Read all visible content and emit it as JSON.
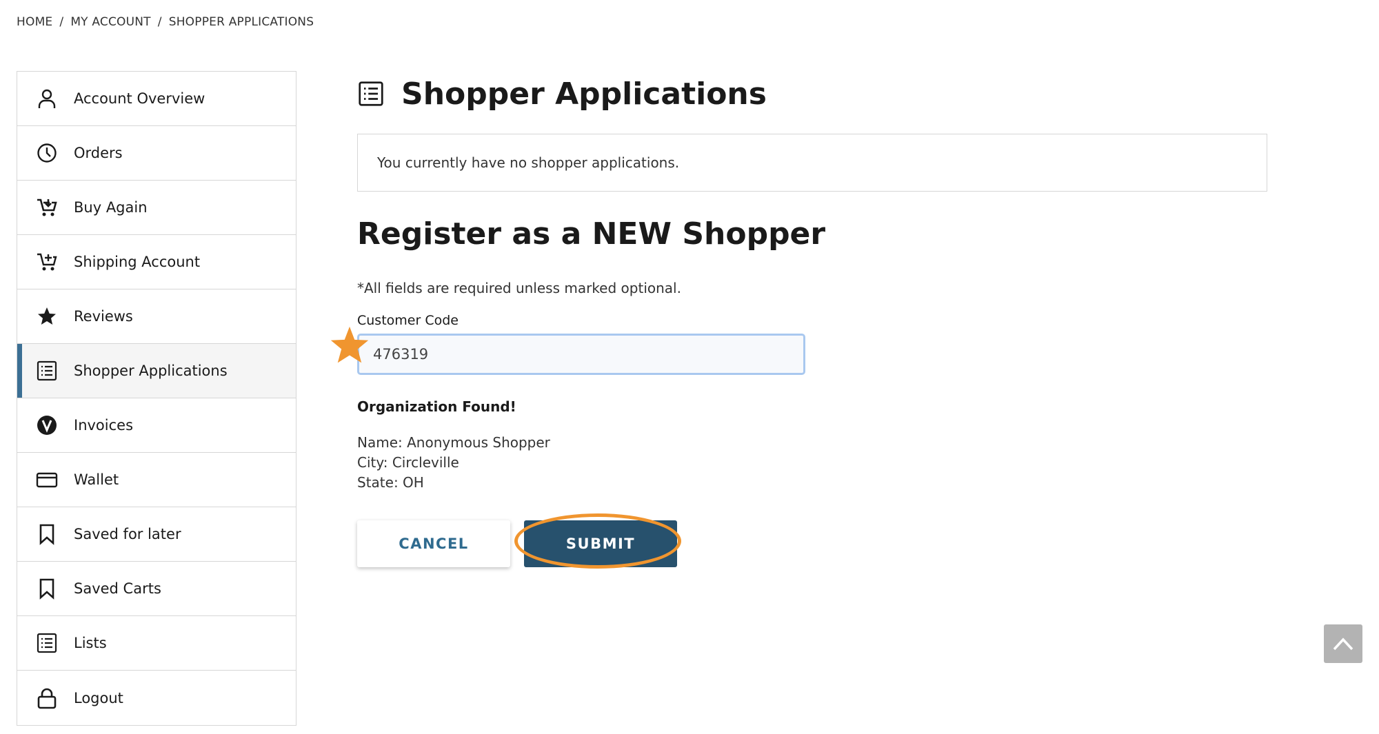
{
  "breadcrumb": {
    "items": [
      "HOME",
      "MY ACCOUNT",
      "SHOPPER APPLICATIONS"
    ],
    "separator": "/"
  },
  "sidebar": {
    "items": [
      {
        "label": "Account Overview",
        "icon": "user-icon"
      },
      {
        "label": "Orders",
        "icon": "clock-icon"
      },
      {
        "label": "Buy Again",
        "icon": "cart-download-icon"
      },
      {
        "label": "Shipping Account",
        "icon": "cart-add-icon"
      },
      {
        "label": "Reviews",
        "icon": "star-icon"
      },
      {
        "label": "Shopper Applications",
        "icon": "list-icon",
        "active": true
      },
      {
        "label": "Invoices",
        "icon": "v-circle-icon"
      },
      {
        "label": "Wallet",
        "icon": "credit-card-icon"
      },
      {
        "label": "Saved for later",
        "icon": "bookmark-icon"
      },
      {
        "label": "Saved Carts",
        "icon": "bookmark-icon"
      },
      {
        "label": "Lists",
        "icon": "list-icon"
      },
      {
        "label": "Logout",
        "icon": "lock-icon"
      }
    ]
  },
  "main": {
    "title": "Shopper Applications",
    "title_icon": "list-icon",
    "notice": "You currently have no shopper applications.",
    "register_title": "Register as a NEW Shopper",
    "required_note": "*All fields are required unless marked optional.",
    "customer_code_label": "Customer Code",
    "customer_code_value": "476319",
    "org_found": "Organization Found!",
    "org_name": "Name: Anonymous Shopper",
    "org_city": "City: Circleville",
    "org_state": "State: OH",
    "cancel_label": "CANCEL",
    "submit_label": "SUBMIT"
  },
  "colors": {
    "accent": "#3b6f94",
    "submit_bg": "#27516d",
    "cancel_text": "#2f6b8f",
    "annotation": "#f0952f",
    "input_border": "#a9c8ef"
  },
  "scroll_top_icon": "chevron-up-icon"
}
